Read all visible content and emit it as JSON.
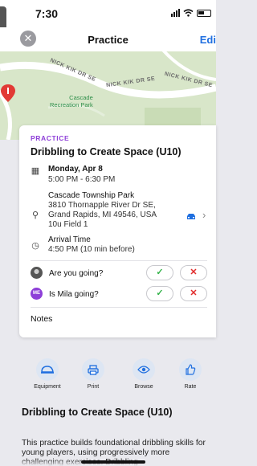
{
  "status_bar": {
    "time": "7:30"
  },
  "nav": {
    "title": "Practice",
    "edit_label": "Edi"
  },
  "map": {
    "street_labels": [
      "NICK KIK DR SE",
      "NICK KIK DR SE",
      "NICK KIK DR SE"
    ],
    "park_label_line1": "Cascade",
    "park_label_line2": "Recreation Park"
  },
  "event": {
    "kind": "PRACTICE",
    "title": "Dribbling to Create Space (U10)",
    "date": "Monday, Apr 8",
    "time_range": "5:00 PM - 6:30 PM",
    "location_name": "Cascade Township Park",
    "address_line1": "3810 Thornapple River Dr SE,",
    "address_line2": "Grand Rapids, MI 49546, USA",
    "field": "10u Field 1",
    "arrival_label": "Arrival Time",
    "arrival_value": "4:50 PM (10 min before)"
  },
  "rsvp": [
    {
      "avatar": "photo",
      "question": "Are you going?"
    },
    {
      "avatar": "ME",
      "question": "Is Mila going?"
    }
  ],
  "rsvp_yes": "✓",
  "rsvp_no": "✕",
  "notes_label": "Notes",
  "toolbar": {
    "equipment": "Equipment",
    "print": "Print",
    "browse": "Browse",
    "rate": "Rate"
  },
  "section": {
    "title": "Dribbling to Create Space (U10)",
    "description": "This practice builds foundational dribbling skills for young players, using progressively more challenging exercises. Dribbling"
  },
  "colors": {
    "accent": "#1f6fe0",
    "kind": "#8e3fd8",
    "yes": "#34b34a",
    "no": "#e12b2b"
  }
}
